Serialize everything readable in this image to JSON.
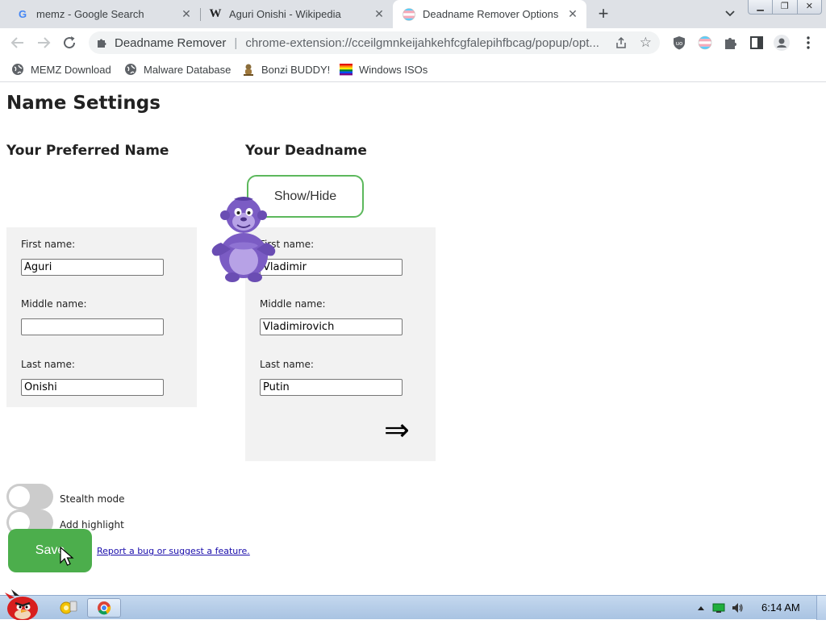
{
  "browser": {
    "tabs": [
      {
        "title": "memz - Google Search",
        "favicon": "google-g-icon"
      },
      {
        "title": "Aguri Onishi - Wikipedia",
        "favicon": "wikipedia-w-icon"
      },
      {
        "title": "Deadname Remover Options",
        "favicon": "trans-flag-icon",
        "active": true
      }
    ],
    "new_tab_symbol": "+",
    "close_symbol": "✕",
    "omnibox": {
      "site_name": "Deadname Remover",
      "separator": "|",
      "url": "chrome-extension://cceilgmnkeijahkehfcgfalepihfbcag/popup/opt..."
    },
    "bookmarks": [
      {
        "label": "MEMZ Download",
        "icon": "globe-icon"
      },
      {
        "label": "Malware Database",
        "icon": "globe-icon"
      },
      {
        "label": "Bonzi BUDDY!",
        "icon": "bonzi-icon"
      },
      {
        "label": "Windows ISOs",
        "icon": "rainbow-flag-icon"
      }
    ]
  },
  "page": {
    "title": "Name Settings",
    "preferred": {
      "heading": "Your Preferred Name",
      "first_label": "First name:",
      "first_value": "Aguri",
      "middle_label": "Middle name:",
      "middle_value": "",
      "last_label": "Last name:",
      "last_value": "Onishi"
    },
    "deadname": {
      "heading": "Your Deadname",
      "show_hide_label": "Show/Hide",
      "first_label": "First name:",
      "first_value": "Vladimir",
      "middle_label": "Middle name:",
      "middle_value": "Vladimirovich",
      "last_label": "Last name:",
      "last_value": "Putin",
      "arrow_symbol": "⇒"
    },
    "stealth_mode_label": "Stealth mode",
    "add_highlight_label": "Add highlight",
    "save_label": "Save",
    "report_link": "Report a bug or suggest a feature."
  },
  "taskbar": {
    "clock": "6:14 AM"
  },
  "colors": {
    "accent_green": "#4cae4c",
    "showhide_border": "#5cb85c",
    "panel_bg": "#f2f2f2",
    "bonzi_purple": "#7b5cc4"
  }
}
